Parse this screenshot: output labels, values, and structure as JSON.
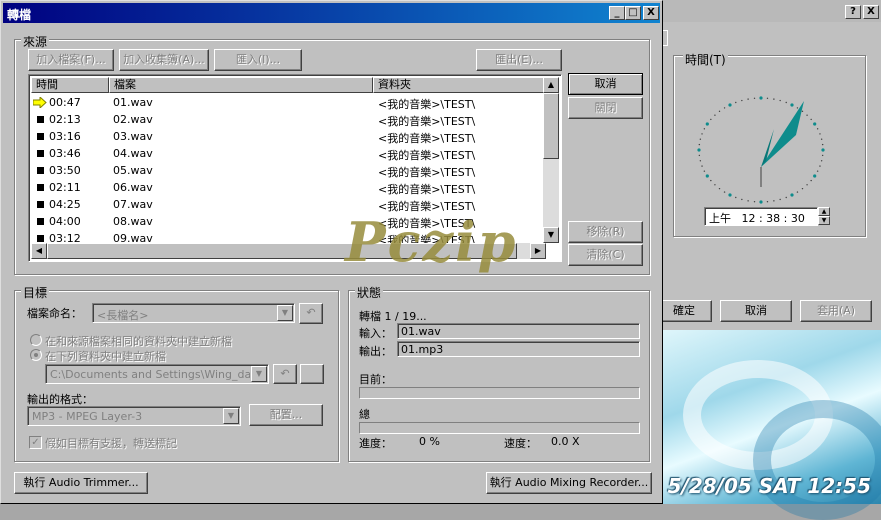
{
  "clock_window": {
    "title_help": "?",
    "title_close": "X",
    "time_group_label": "時間(T)",
    "time_value": "上午   12 : 38 : 30",
    "buttons": {
      "ok": "確定",
      "cancel": "取消",
      "apply": "套用(A)"
    }
  },
  "photo": {
    "datestamp": "5/28/05  SAT 12:55"
  },
  "dialog": {
    "title": "轉檔",
    "caption_buttons": [
      "_",
      "□",
      "X"
    ]
  },
  "source": {
    "group_label": "來源",
    "toolbar": {
      "add_file": "加入檔案(F)...",
      "add_collection": "加入收集簿(A)...",
      "import": "匯入(I)...",
      "export": "匯出(E)..."
    },
    "columns": [
      "時間",
      "檔案",
      "資料夾"
    ],
    "rows": [
      {
        "time": "00:47",
        "file": "01.wav",
        "folder": "<我的音樂>\\TEST\\",
        "current": true
      },
      {
        "time": "02:13",
        "file": "02.wav",
        "folder": "<我的音樂>\\TEST\\",
        "current": false
      },
      {
        "time": "03:16",
        "file": "03.wav",
        "folder": "<我的音樂>\\TEST\\",
        "current": false
      },
      {
        "time": "03:46",
        "file": "04.wav",
        "folder": "<我的音樂>\\TEST\\",
        "current": false
      },
      {
        "time": "03:50",
        "file": "05.wav",
        "folder": "<我的音樂>\\TEST\\",
        "current": false
      },
      {
        "time": "02:11",
        "file": "06.wav",
        "folder": "<我的音樂>\\TEST\\",
        "current": false
      },
      {
        "time": "04:25",
        "file": "07.wav",
        "folder": "<我的音樂>\\TEST\\",
        "current": false
      },
      {
        "time": "04:00",
        "file": "08.wav",
        "folder": "<我的音樂>\\TEST\\",
        "current": false
      },
      {
        "time": "03:12",
        "file": "09.wav",
        "folder": "<我的音樂>\\TEST\\",
        "current": false
      }
    ],
    "side_buttons": {
      "cancel": "取消",
      "close": "關閉",
      "remove": "移除(R)",
      "clear": "清除(C)"
    }
  },
  "target": {
    "group_label": "目標",
    "naming_label": "檔案命名：",
    "naming_value": "<長檔名>",
    "radio_same_folder": "在和來源檔案相同的資料夾中建立新檔",
    "radio_other_folder": "在下列資料夾中建立新檔",
    "folder_value": "C:\\Documents and Settings\\Wing_da_Lee\\M",
    "format_label": "輸出的格式：",
    "format_value": "MP3 - MPEG Layer-3",
    "configure": "配置...",
    "transfer_tags": "假如目標有支援，轉送標記"
  },
  "status": {
    "group_label": "狀態",
    "progress_text": "轉檔 1 / 19...",
    "input_label": "輸入：",
    "input_value": "01.wav",
    "output_label": "輸出：",
    "output_value": "01.mp3",
    "current_label": "目前：",
    "total_label": "總",
    "progress_label": "進度：",
    "progress_value": "0 %",
    "speed_label": "速度：",
    "speed_value": "0.0 X"
  },
  "footer": {
    "audio_trimmer": "執行 Audio Trimmer...",
    "audio_mixing": "執行 Audio Mixing Recorder..."
  },
  "watermark": "Pczip"
}
